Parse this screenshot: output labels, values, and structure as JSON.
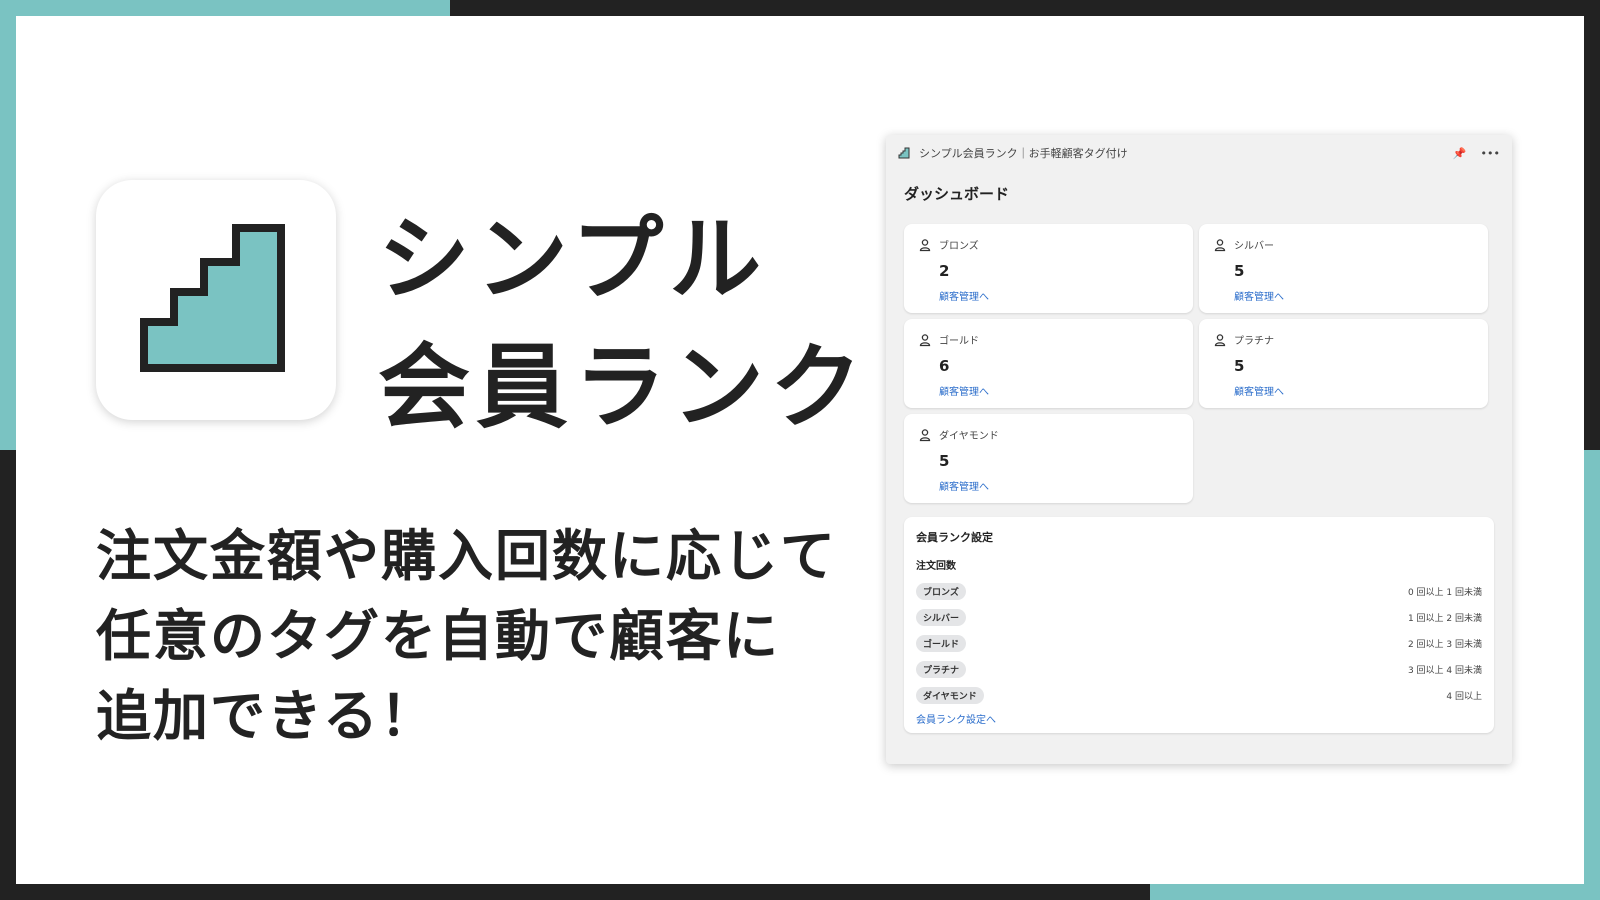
{
  "colors": {
    "accent": "#7AC3C2",
    "frame": "#222222",
    "link": "#2c6ecb"
  },
  "hero": {
    "title_lines": [
      "シンプル",
      "会員ランク"
    ],
    "tagline_lines": [
      "注文金額や購入回数に応じて",
      "任意のタグを自動で顧客に",
      "追加できる！"
    ]
  },
  "window": {
    "title": "シンプル会員ランク｜お手軽顧客タグ付け",
    "pin_icon": "pin-icon",
    "more_icon": "more-icon",
    "dashboard_title": "ダッシュボード",
    "ranks": [
      {
        "name": "ブロンズ",
        "count": "2",
        "link": "顧客管理へ"
      },
      {
        "name": "シルバー",
        "count": "5",
        "link": "顧客管理へ"
      },
      {
        "name": "ゴールド",
        "count": "6",
        "link": "顧客管理へ"
      },
      {
        "name": "プラチナ",
        "count": "5",
        "link": "顧客管理へ"
      },
      {
        "name": "ダイヤモンド",
        "count": "5",
        "link": "顧客管理へ"
      }
    ],
    "settings": {
      "title": "会員ランク設定",
      "subtitle": "注文回数",
      "rows": [
        {
          "badge": "ブロンズ",
          "range": "0 回以上 1 回未満"
        },
        {
          "badge": "シルバー",
          "range": "1 回以上 2 回未満"
        },
        {
          "badge": "ゴールド",
          "range": "2 回以上 3 回未満"
        },
        {
          "badge": "プラチナ",
          "range": "3 回以上 4 回未満"
        },
        {
          "badge": "ダイヤモンド",
          "range": "4 回以上"
        }
      ],
      "link": "会員ランク設定へ"
    }
  }
}
